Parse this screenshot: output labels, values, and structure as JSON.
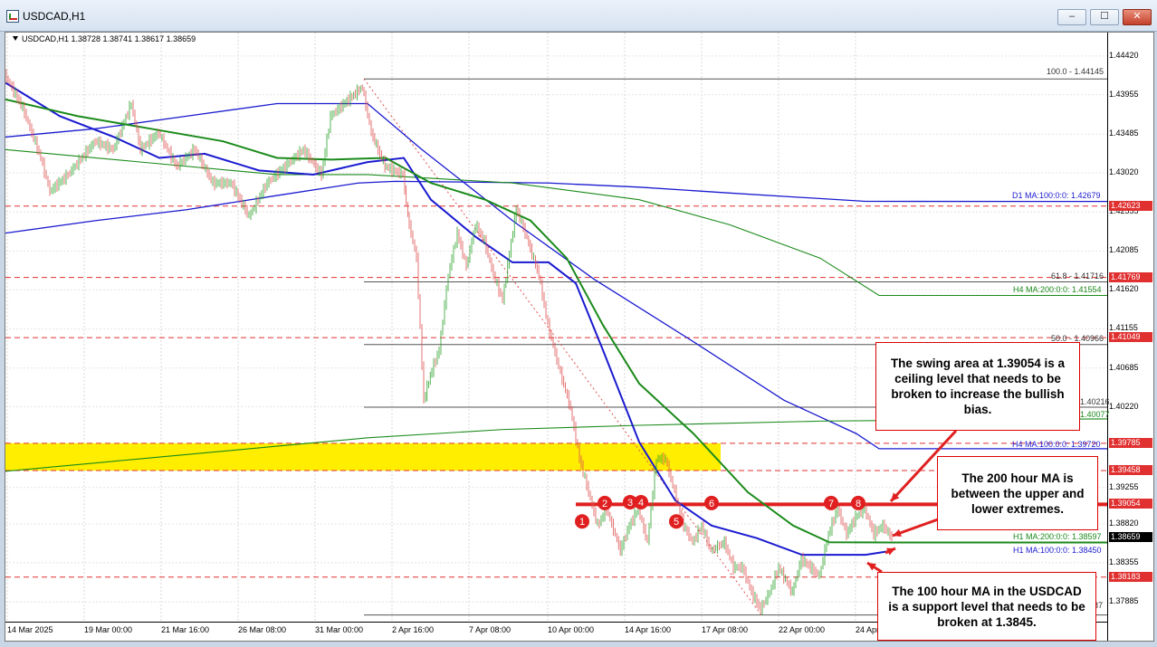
{
  "window": {
    "title": "USDCAD,H1",
    "minimize_label": "‒",
    "maximize_label": "☐",
    "close_label": "✕"
  },
  "chart_header": "USDCAD,H1  1.38728 1.38741 1.38617 1.38659",
  "price_ticks": [
    "1.44420",
    "1.43955",
    "1.43485",
    "1.43020",
    "1.42555",
    "1.42085",
    "1.41620",
    "1.41155",
    "1.40685",
    "1.40220",
    "1.39255",
    "1.38820",
    "1.38355",
    "1.37885"
  ],
  "price_tags": [
    {
      "text": "1.42623",
      "color": "#e03030"
    },
    {
      "text": "1.41769",
      "color": "#e03030"
    },
    {
      "text": "1.41049",
      "color": "#e03030"
    },
    {
      "text": "1.39785",
      "color": "#e03030"
    },
    {
      "text": "1.39458",
      "color": "#e03030"
    },
    {
      "text": "1.39054",
      "color": "#e03030"
    },
    {
      "text": "1.38659",
      "color": "#000000"
    },
    {
      "text": "1.38183",
      "color": "#e03030"
    }
  ],
  "time_ticks": [
    "14 Mar 2025",
    "19 Mar 00:00",
    "21 Mar 16:00",
    "26 Mar 08:00",
    "31 Mar 00:00",
    "2 Apr 16:00",
    "7 Apr 08:00",
    "10 Apr 00:00",
    "14 Apr 16:00",
    "17 Apr 08:00",
    "22 Apr 00:00",
    "24 Apr"
  ],
  "line_labels": {
    "fib100": "100.0 - 1.44145",
    "d1ma": "D1 MA:100:0:0: 1.42679",
    "fib618": "61.8 - 1.41716",
    "h4ma200": "H4 MA:200:0:0: 1.41554",
    "fib50": "50.0 - 1.40966",
    "lvl40216": "1.40216",
    "lvl40077": "1.40077",
    "h4ma100": "H4 MA:100:0:0: 1.39720",
    "h1ma200": "H1 MA:200:0:0: 1.38597",
    "h1ma100": "H1 MA:100:0:0: 1.38450",
    "lvl87": "87"
  },
  "markers": [
    "1",
    "2",
    "3",
    "4",
    "5",
    "6",
    "7",
    "8"
  ],
  "callouts": {
    "swing": "The swing area at 1.39054 is a ceiling level that needs to be broken to increase the bullish bias.",
    "ma200": "The 200 hour MA is between the upper and lower extremes.",
    "ma100": "The 100 hour MA in the USDCAD is a support level that needs to be broken at 1.3845."
  },
  "colors": {
    "fib_line": "#555555",
    "red_level": "#e03030",
    "green_ma": "#1a8a1a",
    "blue_ma": "#1a1ad0",
    "yellow_zone": "#ffee00",
    "candle_up": "#2aa02a",
    "candle_down": "#e05050"
  },
  "chart_data": {
    "type": "line",
    "symbol": "USDCAD",
    "timeframe": "H1",
    "ohlc_current": {
      "open": 1.38728,
      "high": 1.38741,
      "low": 1.38617,
      "close": 1.38659
    },
    "ylim": [
      1.3765,
      1.447
    ],
    "x": [
      "14 Mar 2025",
      "19 Mar 00:00",
      "21 Mar 16:00",
      "26 Mar 08:00",
      "31 Mar 00:00",
      "2 Apr 16:00",
      "7 Apr 08:00",
      "10 Apr 00:00",
      "14 Apr 16:00",
      "17 Apr 08:00",
      "22 Apr 00:00",
      "24 Apr"
    ],
    "series": [
      {
        "name": "price",
        "values": [
          1.441,
          1.434,
          1.432,
          1.425,
          1.439,
          1.43,
          1.422,
          1.407,
          1.396,
          1.39,
          1.382,
          1.3866
        ]
      }
    ],
    "horizontal_levels": [
      1.44145,
      1.42679,
      1.42623,
      1.41769,
      1.41716,
      1.41554,
      1.41049,
      1.40966,
      1.40216,
      1.40077,
      1.39785,
      1.3972,
      1.39458,
      1.39054,
      1.38659,
      1.38597,
      1.3845,
      1.38183
    ],
    "zone": [
      1.39458,
      1.39785
    ]
  }
}
